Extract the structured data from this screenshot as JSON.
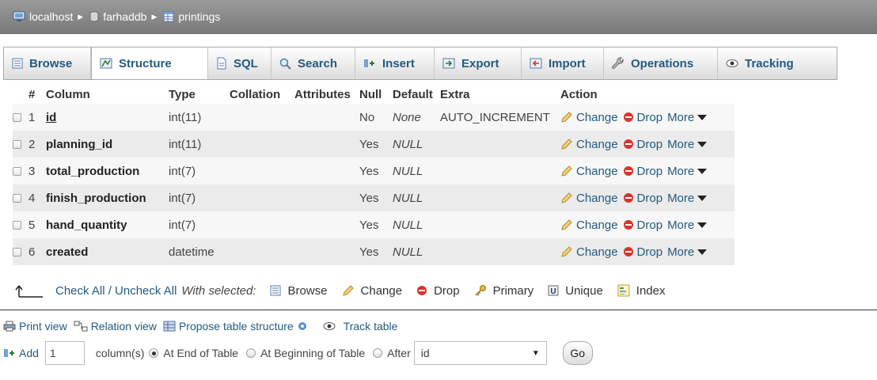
{
  "breadcrumb": {
    "server": "localhost",
    "database": "farhaddb",
    "table": "printings"
  },
  "tabs": [
    {
      "label": "Browse",
      "icon": "browse-icon"
    },
    {
      "label": "Structure",
      "icon": "structure-icon"
    },
    {
      "label": "SQL",
      "icon": "sql-icon"
    },
    {
      "label": "Search",
      "icon": "search-icon"
    },
    {
      "label": "Insert",
      "icon": "insert-icon"
    },
    {
      "label": "Export",
      "icon": "export-icon"
    },
    {
      "label": "Import",
      "icon": "import-icon"
    },
    {
      "label": "Operations",
      "icon": "wrench-icon"
    },
    {
      "label": "Tracking",
      "icon": "eye-icon"
    }
  ],
  "table": {
    "headers": {
      "num": "#",
      "column": "Column",
      "type": "Type",
      "collation": "Collation",
      "attributes": "Attributes",
      "null": "Null",
      "default": "Default",
      "extra": "Extra",
      "action": "Action"
    },
    "rows": [
      {
        "num": "1",
        "name": "id",
        "type": "int(11)",
        "null": "No",
        "default": "None",
        "extra": "AUTO_INCREMENT"
      },
      {
        "num": "2",
        "name": "planning_id",
        "type": "int(11)",
        "null": "Yes",
        "default": "NULL",
        "extra": ""
      },
      {
        "num": "3",
        "name": "total_production",
        "type": "int(7)",
        "null": "Yes",
        "default": "NULL",
        "extra": ""
      },
      {
        "num": "4",
        "name": "finish_production",
        "type": "int(7)",
        "null": "Yes",
        "default": "NULL",
        "extra": ""
      },
      {
        "num": "5",
        "name": "hand_quantity",
        "type": "int(7)",
        "null": "Yes",
        "default": "NULL",
        "extra": ""
      },
      {
        "num": "6",
        "name": "created",
        "type": "datetime",
        "null": "Yes",
        "default": "NULL",
        "extra": ""
      }
    ],
    "actions": {
      "change": "Change",
      "drop": "Drop",
      "more": "More"
    }
  },
  "checkbar": {
    "check_all": "Check All / Uncheck All",
    "with_selected": "With selected:",
    "browse": "Browse",
    "change": "Change",
    "drop": "Drop",
    "primary": "Primary",
    "unique": "Unique",
    "index": "Index"
  },
  "links": {
    "print_view": "Print view",
    "relation_view": "Relation view",
    "propose": "Propose table structure",
    "track_table": "Track table"
  },
  "add": {
    "label": "Add",
    "count": "1",
    "columns_text": "column(s)",
    "at_end": "At End of Table",
    "at_beginning": "At Beginning of Table",
    "after": "After",
    "after_value": "id",
    "go": "Go"
  },
  "colors": {
    "link": "#235a81",
    "crumb_bar": "#8a8a8a",
    "drop_red": "#d9342b"
  }
}
